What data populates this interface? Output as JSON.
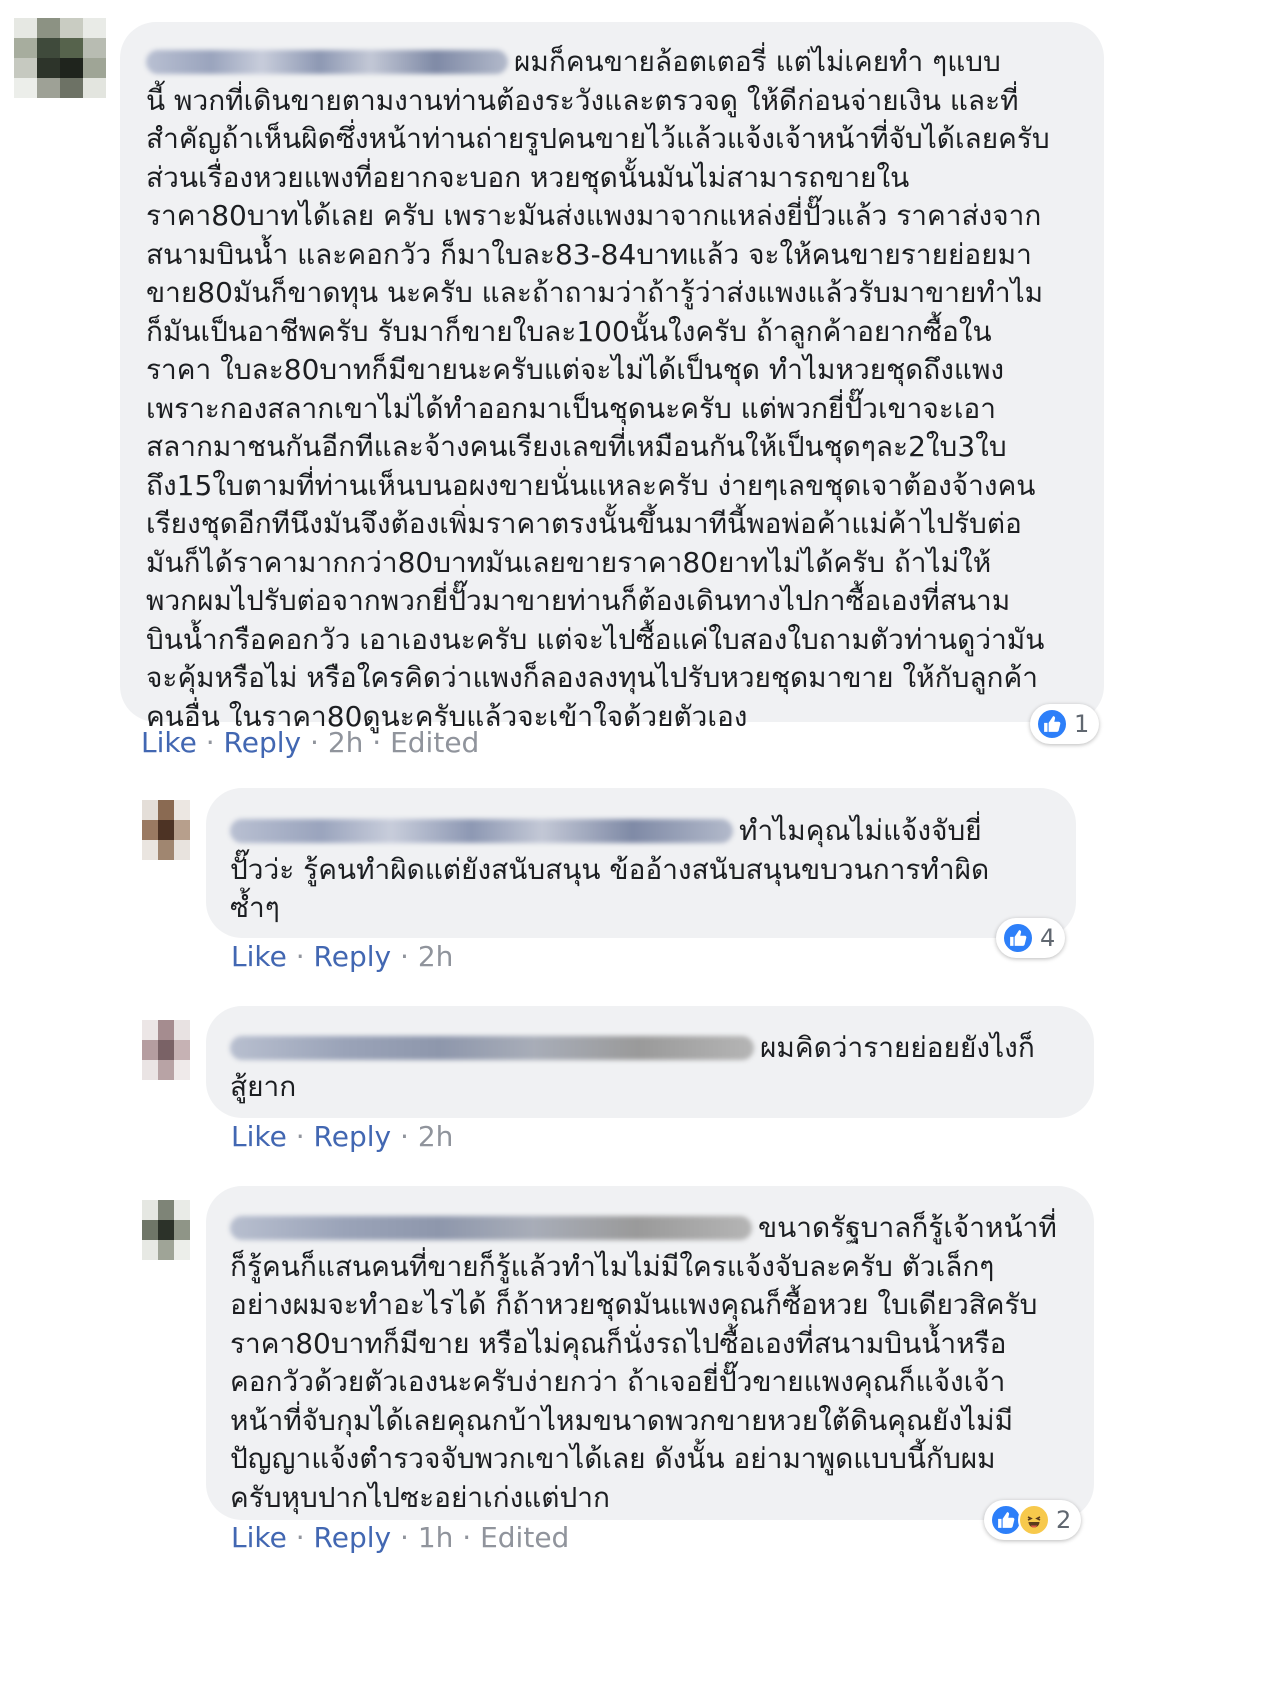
{
  "comments": [
    {
      "lines": [
        "ผมก็คนขายล้อตเตอรี่ แต่ไม่เคยทำ ๆแบบ",
        "นี้ พวกที่เดินขายตามงานท่านต้องระวังและตรวจดู ให้ดีก่อนจ่ายเงิน และที่",
        "สำคัญถ้าเห็นผิดซึ่งหน้าท่านถ่ายรูปคนขายไว้แล้วแจ้งเจ้าหน้าที่จับได้เลยครับ",
        "ส่วนเรื่องหวยแพงที่อยากจะบอก หวยชุดนั้นมันไม่สามารถขายใน",
        "ราคา80บาทได้เลย ครับ เพราะมันส่งแพงมาจากแหล่งยี่ปั๊วแล้ว ราคาส่งจาก",
        "สนามบินน้ำ และคอกวัว ก็มาใบละ83-84บาทแล้ว จะให้คนขายรายย่อยมา",
        "ขาย80มันก็ขาดทุน นะครับ และถ้าถามว่าถ้ารู้ว่าส่งแพงแล้วรับมาขายทำไม",
        "ก็มันเป็นอาชีพครับ รับมาก็ขายใบละ100นั้นใงครับ ถ้าลูกค้าอยากซื้อใน",
        "ราคา ใบละ80บาทก็มีขายนะครับแต่จะไม่ได้เป็นชุด ทำไมหวยชุดถึงแพง",
        "เพราะกองสลากเขาไม่ได้ทำออกมาเป็นชุดนะครับ แต่พวกยี่ปั๊วเขาจะเอา",
        "สลากมาชนกันอีกทีและจ้างคนเรียงเลขที่เหมือนกันให้เป็นชุดๆละ2ใบ3ใบ",
        "ถึง15ใบตามที่ท่านเห็นบนอผงขายนั่นแหละครับ ง่ายๆเลขชุดเจาต้องจ้างคน",
        "เรียงชุดอีกทีนึงมันจึงต้องเพิ่มราคาตรงนั้นขึ้นมาทีนี้พอพ่อค้าแม่ค้าไปรับต่อ",
        "มันก็ได้ราคามากกว่า80บาทมันเลยขายราคา80ยาทไม่ได้ครับ ถ้าไม่ให้",
        "พวกผมไปรับต่อจากพวกยี่ปั๊วมาขายท่านก็ต้องเดินทางไปกาซื้อเองที่สนาม",
        "บินน้ำกรือคอกวัว เอาเองนะครับ แต่จะไปซื้อแค่ใบสองใบถามตัวท่านดูว่ามัน",
        "จะคุ้มหรือไม่ หรือใครคิดว่าแพงก็ลองลงทุนไปรับหวยชุดมาขาย ให้กับลูกค้า",
        "คนอื่น ในราคา80ดูนะครับแล้วจะเข้าใจด้วยตัวเอง"
      ],
      "like": "Like",
      "reply": "Reply",
      "time": "2h",
      "edited": "Edited",
      "reaction_count": "1"
    },
    {
      "lines": [
        "ทำไมคุณไม่แจ้งจับยี่",
        "ปั๊วว่ะ รู้คนทำผิดแต่ยังสนับสนุน ข้ออ้างสนับสนุนขบวนการทำผิด",
        "ซ้ำๆ"
      ],
      "like": "Like",
      "reply": "Reply",
      "time": "2h",
      "reaction_count": "4"
    },
    {
      "lines": [
        "ผมคิดว่ารายย่อยยังไงก็",
        "สู้ยาก"
      ],
      "like": "Like",
      "reply": "Reply",
      "time": "2h"
    },
    {
      "lines": [
        "ขนาดรัฐบาลก็รู้เจ้าหน้าที่",
        "ก็รู้คนก็แสนคนที่ขายก็รู้แล้วทำไมไม่มีใครแจ้งจับละครับ ตัวเล็กๆ",
        "อย่างผมจะทำอะไรได้ ก็ถ้าหวยชุดมันแพงคุณก็ซื้อหวย ใบเดียวสิครับ",
        "ราคา80บาทก็มีขาย หรือไม่คุณก็นั่งรถไปซื้อเองที่สนามบินน้ำหรือ",
        "คอกวัวด้วยตัวเองนะครับง่ายกว่า ถ้าเจอยี่ปั๊วขายแพงคุณก็แจ้งเจ้า",
        "หน้าที่จับกุมได้เลยคุณกบ้าไหมขนาดพวกขายหวยใต้ดินคุณยังไม่มี",
        "ปัญญาแจ้งตำรวจจับพวกเขาได้เลย ดังนั้น อย่ามาพูดแบบนี้กับผม",
        "ครับหุบปากไปซะอย่าเก่งแต่ปาก"
      ],
      "like": "Like",
      "reply": "Reply",
      "time": "1h",
      "edited": "Edited",
      "reaction_count": "2"
    }
  ]
}
